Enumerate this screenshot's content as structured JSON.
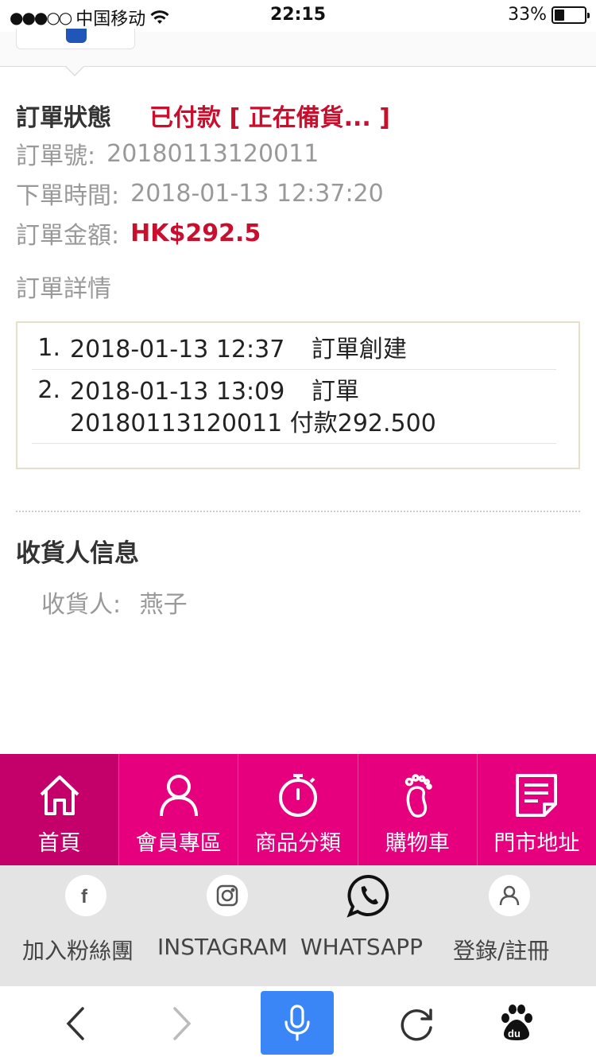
{
  "status_bar": {
    "carrier": "中国移动",
    "signal_dots": "●●●○○",
    "time": "22:15",
    "battery": "33%"
  },
  "order": {
    "status_label": "訂單狀態",
    "status_value": "已付款 [ 正在備貨... ]",
    "number_label": "訂單號:",
    "number_value": "20180113120011",
    "time_label": "下單時間:",
    "time_value": "2018-01-13 12:37:20",
    "amount_label": "訂單金額:",
    "amount_value": "HK$292.5",
    "detail_title": "訂單詳情",
    "log": [
      {
        "num": "1.",
        "time": "2018-01-13 12:37",
        "text": "訂單創建"
      },
      {
        "num": "2.",
        "time": "2018-01-13 13:09",
        "text": "訂單20180113120011 付款292.500"
      }
    ]
  },
  "receiver": {
    "title": "收貨人信息",
    "label": "收貨人:",
    "name": "燕子"
  },
  "nav": {
    "items": [
      {
        "label": "首頁",
        "icon": "home-icon"
      },
      {
        "label": "會員專區",
        "icon": "person-icon"
      },
      {
        "label": "商品分類",
        "icon": "stopwatch-icon"
      },
      {
        "label": "購物車",
        "icon": "footprint-icon"
      },
      {
        "label": "門市地址",
        "icon": "note-icon"
      }
    ],
    "active_index": 0
  },
  "social": {
    "items": [
      {
        "label": "加入粉絲團",
        "icon": "facebook-icon"
      },
      {
        "label": "INSTAGRAM",
        "icon": "instagram-icon"
      },
      {
        "label": "WHATSAPP",
        "icon": "whatsapp-icon"
      },
      {
        "label": "登錄/註冊",
        "icon": "user-icon"
      }
    ]
  },
  "browser": {
    "icons": [
      "back-icon",
      "forward-icon",
      "mic-icon",
      "refresh-icon",
      "baidu-icon"
    ]
  },
  "colors": {
    "brand_pink": "#e6007e",
    "active_pink": "#c4006b",
    "status_red": "#c8102e",
    "mic_blue": "#3b86f7"
  }
}
